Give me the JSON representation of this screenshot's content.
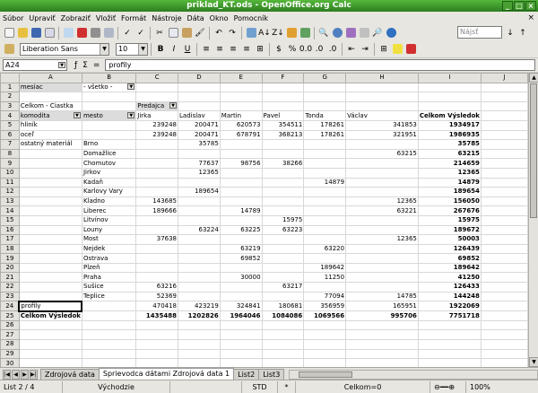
{
  "window": {
    "title": "priklad_KT.ods - OpenOffice.org Calc"
  },
  "menu": [
    "Súbor",
    "Upraviť",
    "Zobraziť",
    "Vložiť",
    "Formát",
    "Nástroje",
    "Dáta",
    "Okno",
    "Pomocník"
  ],
  "format_toolbar": {
    "font": "Liberation Sans",
    "size": "10",
    "bold": "B",
    "italic": "I",
    "underline": "U",
    "find_placeholder": "Nájsť"
  },
  "formula": {
    "namebox": "A24",
    "input": "profily"
  },
  "sheet": {
    "col_headers": [
      "A",
      "B",
      "C",
      "D",
      "E",
      "F",
      "G",
      "H",
      "I",
      "J"
    ],
    "filter_label": "mesiac",
    "filter_value": "- všetko -",
    "data_field": "Celkom - Čiastka",
    "row_field_1": "komodita",
    "row_field_2": "mesto",
    "col_field": "Predajca",
    "col_names": [
      "Jirka",
      "Ladislav",
      "Martin",
      "Pavel",
      "Tonda",
      "Václav",
      "Celkom Výsledok"
    ],
    "rows": [
      [
        "hliník",
        "",
        "239248",
        "200471",
        "620573",
        "354511",
        "178261",
        "341853",
        "1934917"
      ],
      [
        "oceľ",
        "",
        "239248",
        "200471",
        "678791",
        "368213",
        "178261",
        "321951",
        "1986935"
      ],
      [
        "ostatný materiál",
        "Brno",
        "",
        "35785",
        "",
        "",
        "",
        "",
        "35785"
      ],
      [
        "",
        "Domažlice",
        "",
        "",
        "",
        "",
        "",
        "63215",
        "63215"
      ],
      [
        "",
        "Chomutov",
        "",
        "77637",
        "98756",
        "38266",
        "",
        "",
        "214659"
      ],
      [
        "",
        "Jirkov",
        "",
        "12365",
        "",
        "",
        "",
        "",
        "12365"
      ],
      [
        "",
        "Kadaň",
        "",
        "",
        "",
        "",
        "14879",
        "",
        "14879"
      ],
      [
        "",
        "Karlovy Vary",
        "",
        "189654",
        "",
        "",
        "",
        "",
        "189654"
      ],
      [
        "",
        "Kladno",
        "143685",
        "",
        "",
        "",
        "",
        "12365",
        "156050"
      ],
      [
        "",
        "Liberec",
        "189666",
        "",
        "14789",
        "",
        "",
        "63221",
        "267676"
      ],
      [
        "",
        "Litvínov",
        "",
        "",
        "",
        "15975",
        "",
        "",
        "15975"
      ],
      [
        "",
        "Louny",
        "",
        "63224",
        "63225",
        "63223",
        "",
        "",
        "189672"
      ],
      [
        "",
        "Most",
        "37638",
        "",
        "",
        "",
        "",
        "12365",
        "50003"
      ],
      [
        "",
        "Nejdek",
        "",
        "",
        "63219",
        "",
        "63220",
        "",
        "126439"
      ],
      [
        "",
        "Ostrava",
        "",
        "",
        "69852",
        "",
        "",
        "",
        "69852"
      ],
      [
        "",
        "Plzeň",
        "",
        "",
        "",
        "",
        "189642",
        "",
        "189642"
      ],
      [
        "",
        "Praha",
        "",
        "",
        "30000",
        "",
        "11250",
        "",
        "41250"
      ],
      [
        "",
        "Sušice",
        "63216",
        "",
        "",
        "63217",
        "",
        "",
        "126433"
      ],
      [
        "",
        "Teplice",
        "52369",
        "",
        "",
        "",
        "77094",
        "14785",
        "144248"
      ],
      [
        "profily",
        "",
        "470418",
        "423219",
        "324841",
        "180681",
        "356959",
        "165951",
        "1922069"
      ],
      [
        "Celkom Výsledok",
        "",
        "1435488",
        "1202826",
        "1964046",
        "1084086",
        "1069566",
        "995706",
        "7751718"
      ]
    ]
  },
  "tabs": [
    "Zdrojová data",
    "Sprievodca dátami Zdrojová data 1",
    "List2",
    "List3"
  ],
  "status": {
    "sheet": "List 2 / 4",
    "style": "Východzie",
    "mode": "STD",
    "sum": "Celkom=0",
    "zoom": "100%"
  }
}
